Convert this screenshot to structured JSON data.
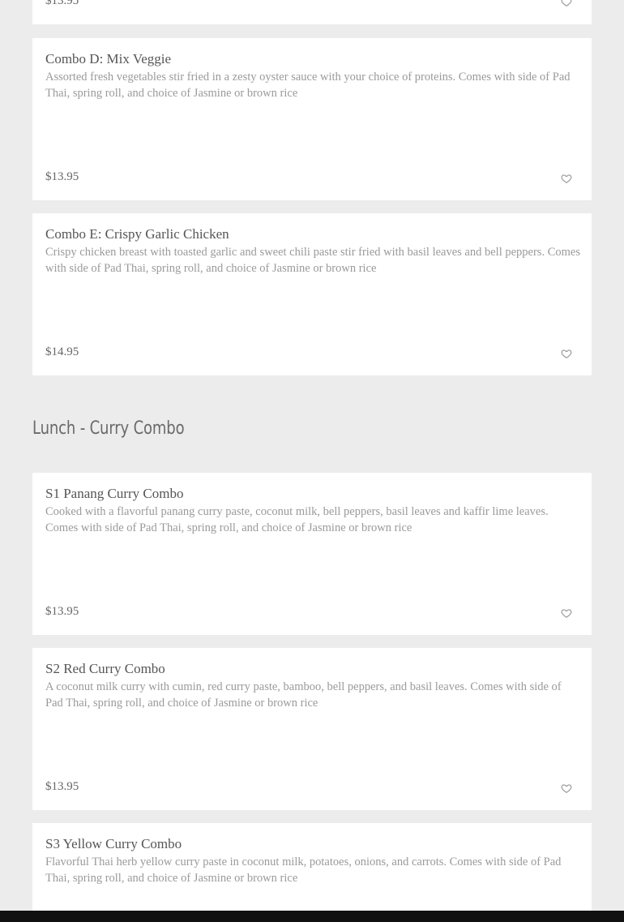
{
  "top_item": {
    "price": "$13.95"
  },
  "lunch_combo_items": [
    {
      "name": "Combo D: Mix Veggie",
      "description": "Assorted fresh vegetables stir fried in a zesty oyster sauce with your choice of proteins. Comes with side of Pad Thai, spring roll, and choice of Jasmine or brown rice",
      "price": "$13.95"
    },
    {
      "name": "Combo E: Crispy Garlic Chicken",
      "description": "Crispy chicken breast with toasted garlic and sweet chili paste stir fried with basil leaves and bell peppers. Comes with side of Pad Thai, spring roll, and choice of Jasmine or brown rice",
      "price": "$14.95"
    }
  ],
  "curry_section": {
    "title": "Lunch - Curry Combo",
    "items": [
      {
        "name": "S1 Panang Curry Combo",
        "description": "Cooked with a flavorful panang curry paste, coconut milk, bell peppers, basil leaves and kaffir lime leaves. Comes with side of Pad Thai, spring roll, and choice of Jasmine or brown rice",
        "price": "$13.95"
      },
      {
        "name": "S2 Red Curry Combo",
        "description": "A coconut milk curry with cumin, red curry paste, bamboo, bell peppers, and basil leaves. Comes with side of Pad Thai, spring roll, and choice of Jasmine or brown rice",
        "price": "$13.95"
      },
      {
        "name": "S3 Yellow Curry Combo",
        "description": "Flavorful Thai herb yellow curry paste in coconut milk, potatoes, onions, and carrots. Comes with side of Pad Thai, spring roll, and choice of Jasmine or brown rice"
      }
    ]
  },
  "icons": {
    "favorite": "heart-outline-icon"
  },
  "colors": {
    "background": "#ececec",
    "card": "#ffffff",
    "heart": "#999999"
  }
}
